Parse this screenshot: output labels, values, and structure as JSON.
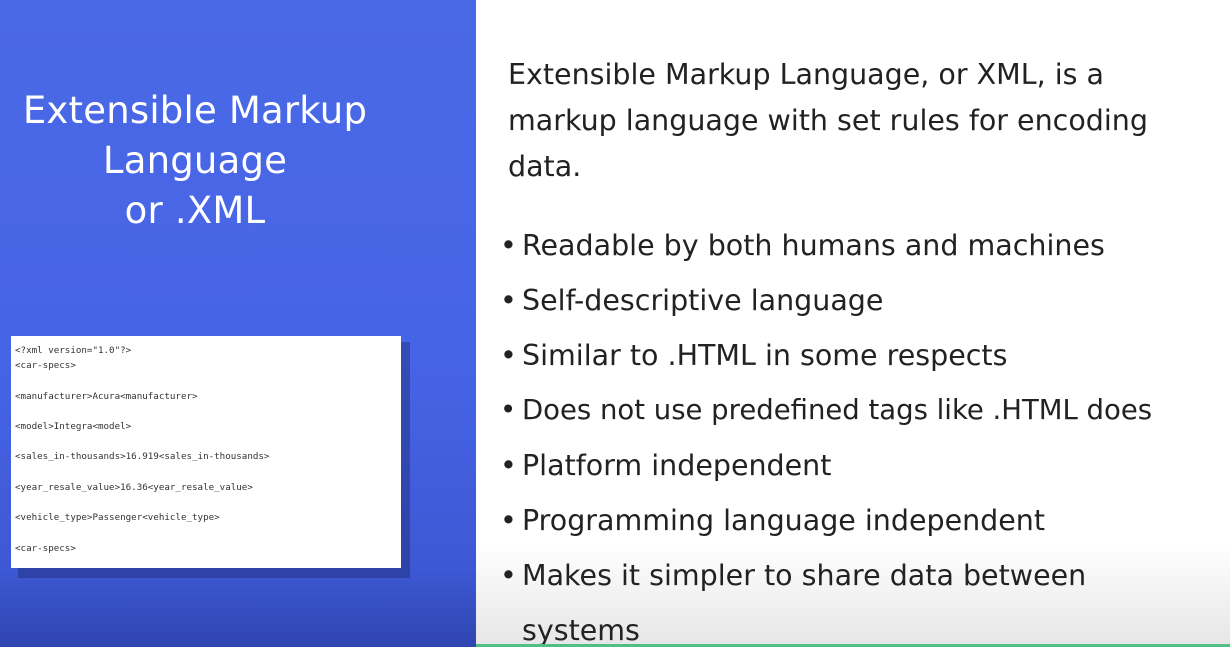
{
  "slide": {
    "title_lines": [
      "Extensible Markup",
      "Language",
      "or .XML"
    ],
    "code_lines": [
      "<?xml version=\"1.0\"?>",
      "<car-specs>",
      "",
      "<manufacturer>Acura<manufacturer>",
      "",
      "<model>Integra<model>",
      "",
      "<sales_in-thousands>16.919<sales_in-thousands>",
      "",
      "<year_resale_value>16.36<year_resale_value>",
      "",
      "<vehicle_type>Passenger<vehicle_type>",
      "",
      "<car-specs>"
    ],
    "intro": "Extensible Markup Language, or XML, is a markup language with set rules for encoding data.",
    "bullets": [
      "Readable by both humans and machines",
      "Self-descriptive language",
      "Similar to .HTML in some respects",
      "Does not use predefined tags like .HTML does",
      "Platform independent",
      "Programming language independent",
      "Makes it simpler to share data between systems"
    ],
    "bullet_glyph": "•",
    "colors": {
      "left_panel": "#4664e6",
      "title_text": "#ffffff",
      "body_text": "#222222",
      "accent_bar": "#4fbf86"
    }
  }
}
